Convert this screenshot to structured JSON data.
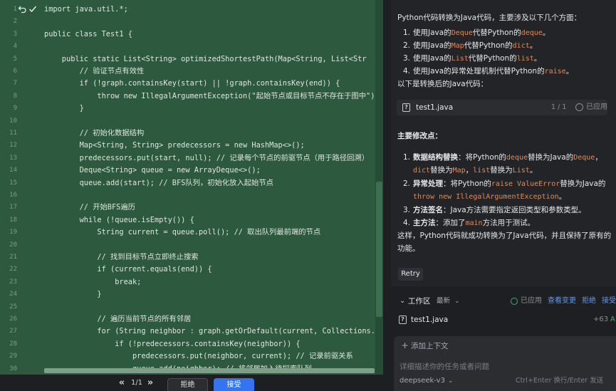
{
  "editor": {
    "line_numbers": [
      "1",
      "2",
      "3",
      "4",
      "5",
      "6",
      "7",
      "8",
      "9",
      "10",
      "11",
      "12",
      "13",
      "14",
      "15",
      "16",
      "17",
      "18",
      "19",
      "20",
      "21",
      "22",
      "23",
      "24",
      "25",
      "26",
      "27",
      "28",
      "29",
      "30"
    ],
    "lines": [
      "import java.util.*;",
      "",
      "public class Test1 {",
      "",
      "    public static List<String> optimizedShortestPath(Map<String, List<Str",
      "        // 验证节点有效性",
      "        if (!graph.containsKey(start) || !graph.containsKey(end)) {",
      "            throw new IllegalArgumentException(\"起始节点或目标节点不存在于图中\");",
      "        }",
      "",
      "        // 初始化数据结构",
      "        Map<String, String> predecessors = new HashMap<>();",
      "        predecessors.put(start, null); // 记录每个节点的前驱节点（用于路径回溯）",
      "        Deque<String> queue = new ArrayDeque<>();",
      "        queue.add(start); // BFS队列，初始化放入起始节点",
      "",
      "        // 开始BFS遍历",
      "        while (!queue.isEmpty()) {",
      "            String current = queue.poll(); // 取出队列最前端的节点",
      "",
      "            // 找到目标节点立即终止搜索",
      "            if (current.equals(end)) {",
      "                break;",
      "            }",
      "",
      "            // 遍历当前节点的所有邻居",
      "            for (String neighbor : graph.getOrDefault(current, Collections.",
      "                if (!predecessors.containsKey(neighbor)) {",
      "                    predecessors.put(neighbor, current); // 记录前驱关系",
      "                    queue.add(neighbor); // 将邻居加入待探索队列"
    ],
    "undo_icon": "undo-icon",
    "check_icon": "check-icon",
    "diff_nav": {
      "prev": "«",
      "count": "1/1",
      "next": "»",
      "reject_label": "拒绝",
      "accept_label": "接受"
    },
    "colors": {
      "background": "#2d5a3f",
      "accept": "#3574f0"
    }
  },
  "answer": {
    "intro": "Python代码转换为Java代码，主要涉及以下几个方面：",
    "points": [
      {
        "n": "1.",
        "pre": "使用Java的",
        "k1": "Deque",
        "mid": "代替Python的",
        "k2": "deque",
        "post": "。"
      },
      {
        "n": "2.",
        "pre": "使用Java的",
        "k1": "Map",
        "mid": "代替Python的",
        "k2": "dict",
        "post": "。"
      },
      {
        "n": "3.",
        "pre": "使用Java的",
        "k1": "List",
        "mid": "代替Python的",
        "k2": "list",
        "post": "。"
      },
      {
        "n": "4.",
        "pre": "使用Java的异常处理机制代替Python的",
        "k1": "raise",
        "mid": "",
        "k2": "",
        "post": "。"
      }
    ],
    "after": "以下是转换后的Java代码：",
    "file_card": {
      "name": "test1.java",
      "count": "1 / 1",
      "status": "已应用"
    },
    "heading": "主要修改点：",
    "changes": {
      "c1_n": "1.",
      "c1_title": "数据结构替换",
      "c1_a": "：将Python的",
      "c1_k1": "deque",
      "c1_b": "替换为Java的",
      "c1_k2": "Deque",
      "c1_c": "，",
      "c1_k3": "dict",
      "c1_d": "替换为",
      "c1_k4": "Map",
      "c1_e": "，",
      "c1_k5": "list",
      "c1_f": "替换为",
      "c1_k6": "List",
      "c1_g": "。",
      "c2_n": "2.",
      "c2_title": "异常处理",
      "c2_a": "：将Python的",
      "c2_k1": "raise ValueError",
      "c2_b": "替换为Java的",
      "c2_k2": "throw new IllegalArgumentException",
      "c2_c": "。",
      "c3_n": "3.",
      "c3_title": "方法签名",
      "c3_a": "：Java方法需要指定返回类型和参数类型。",
      "c4_n": "4.",
      "c4_title": "主方法",
      "c4_a": "：添加了",
      "c4_k1": "main",
      "c4_b": "方法用于测试。"
    },
    "conclusion_1": "这样，Python代码就成功转换为了Java代码，并且保持了原有的",
    "conclusion_2": "功能。",
    "retry_label": "Retry"
  },
  "workspace": {
    "title": "工作区",
    "latest": "最新",
    "status": "已应用",
    "view_changes": "查看变更",
    "reject": "拒绝",
    "accept": "接受",
    "file": {
      "name": "test1.java",
      "added": "+63",
      "flag": "A"
    }
  },
  "composer": {
    "add_context": "添加上下文",
    "placeholder": "详细描述你的任务或者问题",
    "model": "deepseek-v3",
    "hint": "Ctrl+Enter 换行/Enter 发送"
  }
}
